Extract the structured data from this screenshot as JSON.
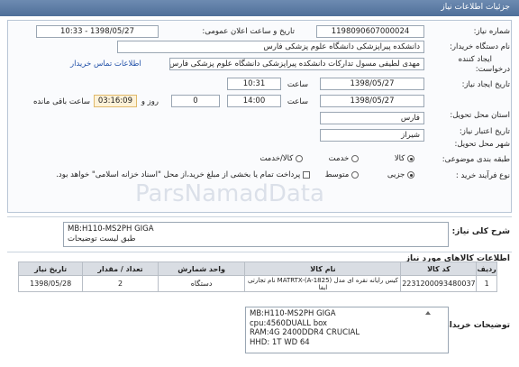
{
  "header": {
    "title": "جزئیات اطلاعات نیاز"
  },
  "form": {
    "need_number_label": "شماره نیاز:",
    "need_number": "1198090607000024",
    "announce_label": "تاریخ و ساعت اعلان عمومی:",
    "announce_value": "1398/05/27 - 10:33",
    "buyer_org_label": "نام دستگاه خریدار:",
    "buyer_org": "دانشکده پیراپزشکی دانشگاه علوم پزشکی فارس",
    "requester_label_1": "ایجاد کننده",
    "requester_label_2": "درخواست:",
    "requester": "مهدی لطیفی مسول تدارکات دانشکده پیراپزشکی دانشگاه علوم پزشکی فارس",
    "contact_link": "اطلاعات تماس خریدار",
    "created_label": "تاریخ ایجاد نیاز:",
    "created_date": "1398/05/27",
    "time_label": "ساعت",
    "created_time": "10:31",
    "deadline_label": "تاریخ اعتبار نیاز:",
    "deadline_date": "1398/05/27",
    "deadline_time_label": "ساعت",
    "deadline_time": "14:00",
    "days_value": "0",
    "days_label": "روز و",
    "remaining_time": "03:16:09",
    "remaining_label": "ساعت باقی مانده",
    "province_label": "استان محل تحویل:",
    "province": "فارس",
    "city_label": "شهر محل تحویل:",
    "city": "شیراز",
    "category_label": "طبقه بندی موضوعی:",
    "category_options": [
      "کالا",
      "خدمت",
      "کالا/خدمت"
    ],
    "category_selected": 0,
    "purchase_type_label": "نوع فرآیند خرید :",
    "purchase_options": [
      "جزیی",
      "متوسط"
    ],
    "purchase_selected": 0,
    "payment_note": "پرداخت تمام یا بخشی از مبلغ خرید،از محل \"اسناد خزانه اسلامی\" خواهد بود."
  },
  "summary": {
    "label": "شرح کلی نیاز:",
    "line1": "MB:H110-MS2PH GIGA",
    "line2": "طبق لیست توضیحات"
  },
  "items": {
    "section_title": "اطلاعات کالاهای مورد نیاز",
    "columns": [
      "ردیف",
      "کد کالا",
      "نام کالا",
      "واحد شمارش",
      "تعداد / مقدار",
      "تاریخ نیاز"
    ],
    "rows": [
      [
        "1",
        "2231200093480037",
        "کیس رایانه نقره ای مدل MATRTX-(A-1825) نام تجارتی ایفا",
        "دستگاه",
        "2",
        "1398/05/28"
      ]
    ]
  },
  "buyer_desc": {
    "label": "توضیحات خریدار:",
    "lines": [
      "MB:H110-MS2PH GIGA",
      "cpu:4560DUALL box",
      "RAM:4G 2400DDR4 CRUCIAL",
      "HHD: 1T WD 64"
    ]
  },
  "watermark": {
    "text": "ParsNamadData"
  }
}
